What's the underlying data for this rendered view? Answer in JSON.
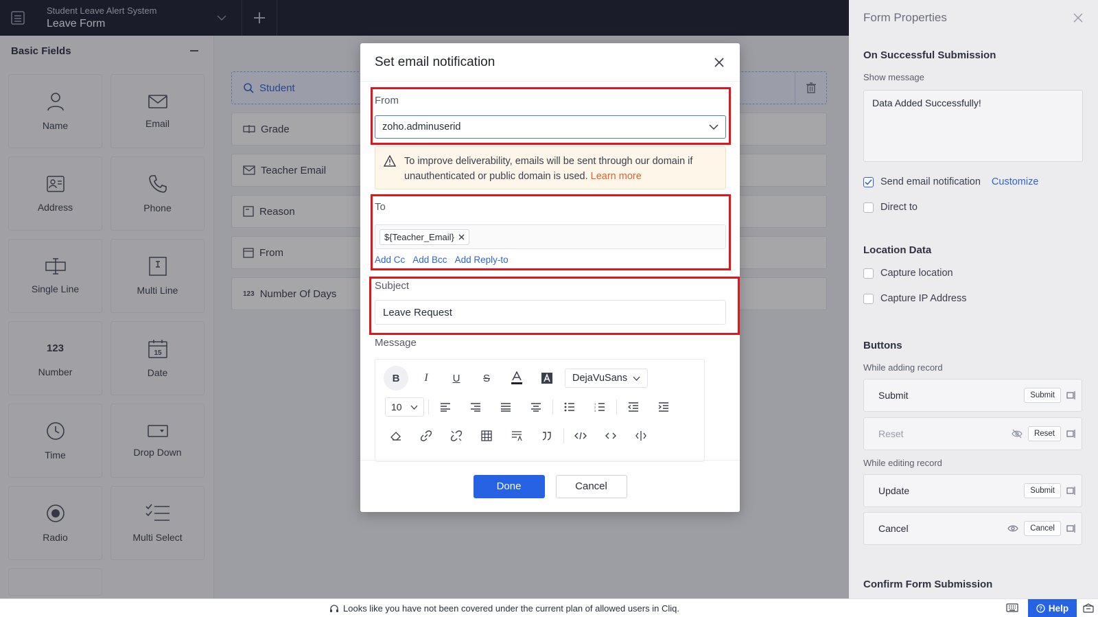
{
  "topbar": {
    "app_name": "Student Leave Alert System",
    "form_name": "Leave Form"
  },
  "left_panel": {
    "title": "Basic Fields",
    "fields": [
      {
        "label": "Name",
        "icon": "person-icon"
      },
      {
        "label": "Email",
        "icon": "envelope-icon"
      },
      {
        "label": "Address",
        "icon": "address-card-icon"
      },
      {
        "label": "Phone",
        "icon": "phone-icon"
      },
      {
        "label": "Single Line",
        "icon": "single-line-icon"
      },
      {
        "label": "Multi Line",
        "icon": "multi-line-icon"
      },
      {
        "label": "Number",
        "icon": "number-icon",
        "glyph": "123"
      },
      {
        "label": "Date",
        "icon": "calendar-icon",
        "glyph": "15"
      },
      {
        "label": "Time",
        "icon": "clock-icon"
      },
      {
        "label": "Drop Down",
        "icon": "dropdown-icon"
      },
      {
        "label": "Radio",
        "icon": "radio-icon"
      },
      {
        "label": "Multi Select",
        "icon": "checklist-icon"
      }
    ]
  },
  "canvas": {
    "fields": [
      {
        "label": "Student",
        "icon": "search-icon"
      },
      {
        "label": "Grade",
        "icon": "single-line-icon"
      },
      {
        "label": "Teacher Email",
        "icon": "envelope-icon"
      },
      {
        "label": "Reason",
        "icon": "multi-line-icon"
      },
      {
        "label": "From",
        "icon": "calendar-icon"
      },
      {
        "label": "Number Of Days",
        "icon": "number-icon",
        "glyph": "123"
      }
    ]
  },
  "modal": {
    "title": "Set email notification",
    "from_label": "From",
    "from_value": "zoho.adminuserid",
    "warning_text": "To improve deliverability, emails will be sent through our domain if unauthenticated or public domain is used.",
    "warning_link": "Learn more",
    "to_label": "To",
    "to_chip": "${Teacher_Email}",
    "links": [
      "Add Cc",
      "Add Bcc",
      "Add Reply-to"
    ],
    "subject_label": "Subject",
    "subject_value": "Leave Request",
    "message_label": "Message",
    "editor": {
      "font": "DejaVuSans",
      "size": "10"
    },
    "done_label": "Done",
    "cancel_label": "Cancel"
  },
  "right_panel": {
    "title": "Form Properties",
    "on_success_title": "On Successful Submission",
    "show_message_label": "Show message",
    "message_value": "Data Added Successfully!",
    "send_email_label": "Send email notification",
    "send_email_checked": true,
    "customize_label": "Customize",
    "direct_to_label": "Direct to",
    "location_title": "Location Data",
    "capture_location_label": "Capture location",
    "capture_ip_label": "Capture IP Address",
    "buttons_title": "Buttons",
    "while_adding_label": "While adding record",
    "while_editing_label": "While editing record",
    "buttons": [
      {
        "name": "Submit",
        "tag": "Submit"
      },
      {
        "name": "Reset",
        "tag": "Reset"
      },
      {
        "name": "Update",
        "tag": "Submit"
      },
      {
        "name": "Cancel",
        "tag": "Cancel"
      }
    ],
    "confirm_title": "Confirm Form Submission"
  },
  "bottombar": {
    "notice": "Looks like you have not been covered under the current plan of allowed users in Cliq.",
    "help_label": "Help"
  },
  "colors": {
    "accent": "#2563e4",
    "highlight": "#e3151b",
    "topbar": "#1d2133"
  }
}
